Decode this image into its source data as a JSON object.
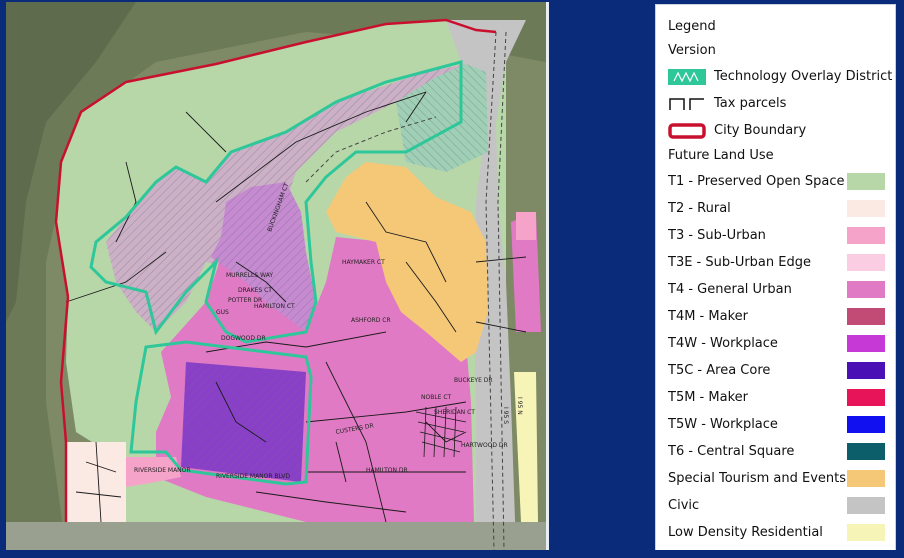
{
  "legend": {
    "title": "Legend",
    "version_label": "Version",
    "symbols": [
      {
        "label": "Technology Overlay District",
        "icon": "hatched-green-outline-icon",
        "color": "#2ec79a"
      },
      {
        "label": "Tax parcels",
        "icon": "parcel-line-icon",
        "color": "#111111"
      },
      {
        "label": "City Boundary",
        "icon": "red-outline-icon",
        "color": "#c8102e"
      }
    ],
    "future_land_use_label": "Future Land Use",
    "land_use": [
      {
        "label": "T1 - Preserved Open Space",
        "color": "#b7d7a8"
      },
      {
        "label": "T2 - Rural",
        "color": "#fbe9e4"
      },
      {
        "label": "T3 - Sub-Urban",
        "color": "#f5a3c8"
      },
      {
        "label": "T3E - Sub-Urban Edge",
        "color": "#fbcde3"
      },
      {
        "label": "T4 - General Urban",
        "color": "#e07ac4"
      },
      {
        "label": "T4M - Maker",
        "color": "#c24b76"
      },
      {
        "label": "T4W - Workplace",
        "color": "#c639d6"
      },
      {
        "label": "T5C - Area Core",
        "color": "#4a10b5"
      },
      {
        "label": "T5M - Maker",
        "color": "#e8145a"
      },
      {
        "label": "T5W - Workplace",
        "color": "#1010f0"
      },
      {
        "label": "T6 - Central Square",
        "color": "#0d5e6b"
      },
      {
        "label": "Special Tourism and Events",
        "color": "#f5c878"
      },
      {
        "label": "Civic",
        "color": "#c4c4c4"
      },
      {
        "label": "Low Density Residential",
        "color": "#f7f4b8"
      }
    ]
  },
  "map": {
    "street_labels": [
      "MURRELLS WAY",
      "DRAKES CT",
      "POTTER DR",
      "GUS",
      "HAMILTON CT",
      "HAYMAKER CT",
      "ASHFORD CR",
      "BUCKINGHAM CT",
      "DOGWOOD DR",
      "SHERIDAN CT",
      "NOBLE CT",
      "RIVERSIDE MANOR",
      "RIVERSIDE MANOR BLVD",
      "CUSTERS DR",
      "HAMILTON DR",
      "I 95 S",
      "I 95 N",
      "BUCKEYE DR",
      "HARTWOOD DR"
    ]
  }
}
